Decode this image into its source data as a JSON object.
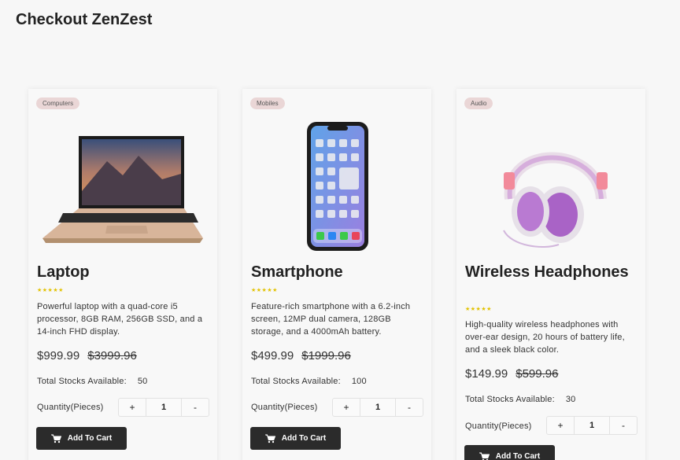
{
  "page": {
    "title": "Checkout ZenZest"
  },
  "products": [
    {
      "category": "Computers",
      "image_icon": "laptop-image",
      "name": "Laptop",
      "stars": "★★★★★",
      "description": "Powerful laptop with a quad-core i5 processor, 8GB RAM, 256GB SSD, and a 14-inch FHD display.",
      "price": "$999.99",
      "old_price": "$3999.96",
      "stock_label": "Total Stocks Available:",
      "stock": "50",
      "quantity_label": "Quantity(Pieces)",
      "plus": "+",
      "quantity": "1",
      "minus": "-",
      "cart_label": "Add To Cart"
    },
    {
      "category": "Mobiles",
      "image_icon": "smartphone-image",
      "name": "Smartphone",
      "stars": "★★★★★",
      "description": "Feature-rich smartphone with a 6.2-inch screen, 12MP dual camera, 128GB storage, and a 4000mAh battery.",
      "price": "$499.99",
      "old_price": "$1999.96",
      "stock_label": "Total Stocks Available:",
      "stock": "100",
      "quantity_label": "Quantity(Pieces)",
      "plus": "+",
      "quantity": "1",
      "minus": "-",
      "cart_label": "Add To Cart"
    },
    {
      "category": "Audio",
      "image_icon": "headphones-image",
      "name": "Wireless Headphones",
      "stars": "★★★★★",
      "description": "High-quality wireless headphones with over-ear design, 20 hours of battery life, and a sleek black color.",
      "price": "$149.99",
      "old_price": "$599.96",
      "stock_label": "Total Stocks Available:",
      "stock": "30",
      "quantity_label": "Quantity(Pieces)",
      "plus": "+",
      "quantity": "1",
      "minus": "-",
      "cart_label": "Add To Cart"
    }
  ],
  "colors": {
    "button": "#2b2b2b",
    "badge": "#ead6d6",
    "stars": "#e2c200"
  }
}
